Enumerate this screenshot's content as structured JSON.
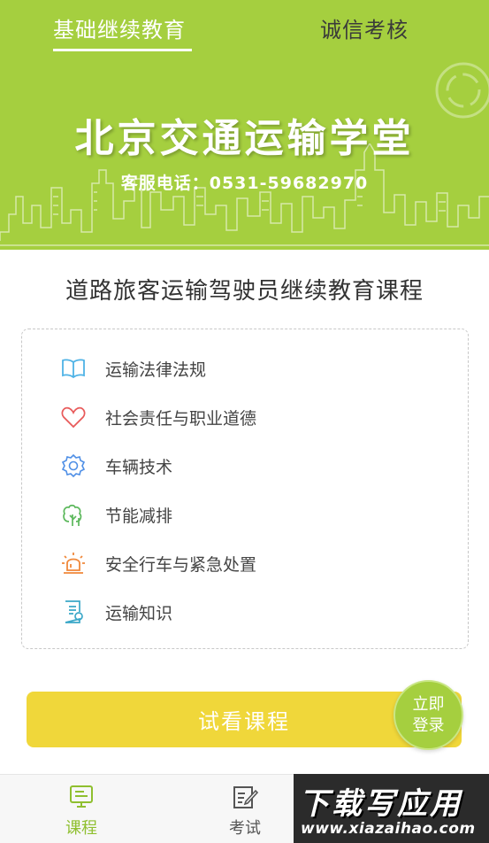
{
  "header": {
    "tabs": [
      {
        "label": "基础继续教育",
        "active": true
      },
      {
        "label": "诚信考核",
        "active": false
      }
    ],
    "brand_title": "北京交通运输学堂",
    "hotline": "客服电话：0531-59682970"
  },
  "course": {
    "title": "道路旅客运输驾驶员继续教育课程",
    "items": [
      {
        "label": "运输法律法规",
        "icon": "book-icon",
        "color": "#4fb3e6"
      },
      {
        "label": "社会责任与职业道德",
        "icon": "heart-icon",
        "color": "#e85a5a"
      },
      {
        "label": "车辆技术",
        "icon": "gear-icon",
        "color": "#4f8fe6"
      },
      {
        "label": "节能减排",
        "icon": "tree-icon",
        "color": "#5cb85c"
      },
      {
        "label": "安全行车与紧急处置",
        "icon": "alarm-light-icon",
        "color": "#f0883a"
      },
      {
        "label": "运输知识",
        "icon": "document-icon",
        "color": "#3aa7c8"
      }
    ]
  },
  "actions": {
    "trial_label": "试看课程",
    "login_line1": "立即",
    "login_line2": "登录"
  },
  "bottom_nav": {
    "items": [
      {
        "label": "课程",
        "icon": "monitor-icon",
        "active": true
      },
      {
        "label": "考试",
        "icon": "exam-edit-icon",
        "active": false
      }
    ]
  },
  "watermark": {
    "title": "下载写应用",
    "url": "www.xiazaihao.com"
  },
  "colors": {
    "brand_green": "#a5cf3f",
    "button_yellow": "#f0d73a",
    "active_nav": "#8fbf2f"
  }
}
